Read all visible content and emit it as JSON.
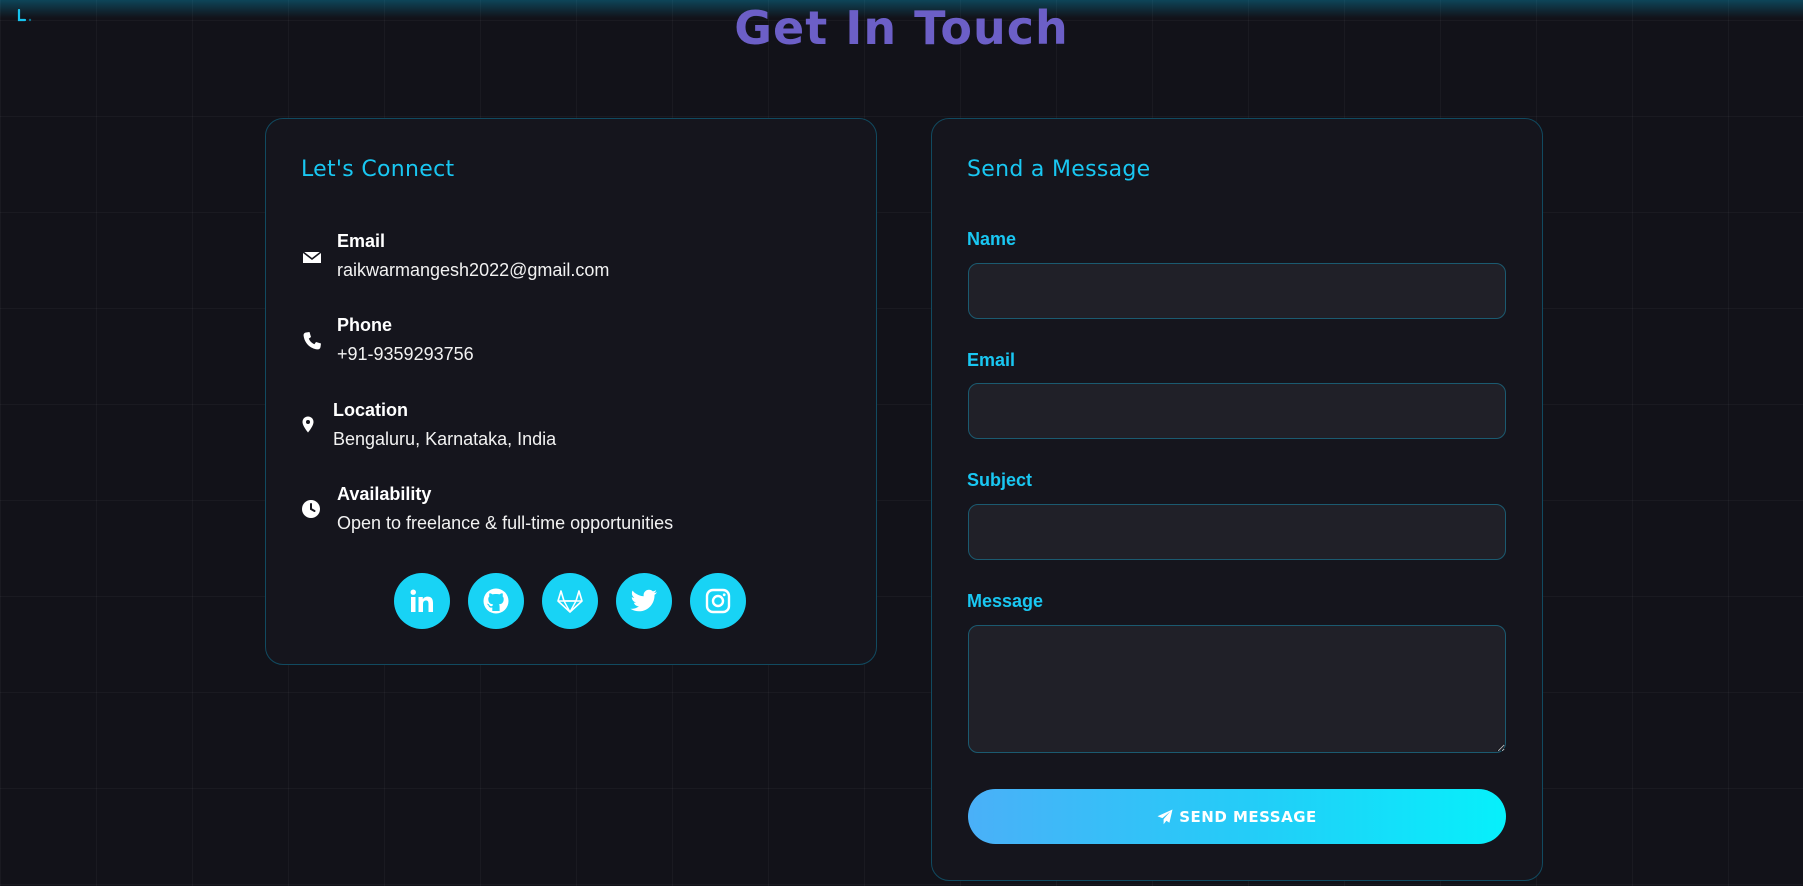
{
  "page": {
    "title": "Get In Touch"
  },
  "connect": {
    "title": "Let's Connect",
    "items": [
      {
        "label": "Email",
        "value": "raikwarmangesh2022@gmail.com",
        "icon": "envelope-icon"
      },
      {
        "label": "Phone",
        "value": "+91-9359293756",
        "icon": "phone-icon"
      },
      {
        "label": "Location",
        "value": "Bengaluru, Karnataka, India",
        "icon": "map-pin-icon"
      },
      {
        "label": "Availability",
        "value": "Open to freelance & full-time opportunities",
        "icon": "clock-icon"
      }
    ],
    "socials": [
      "linkedin-icon",
      "github-icon",
      "gitlab-icon",
      "twitter-icon",
      "instagram-icon"
    ]
  },
  "form": {
    "title": "Send a Message",
    "name_label": "Name",
    "name_value": "",
    "email_label": "Email",
    "email_value": "",
    "subject_label": "Subject",
    "subject_value": "",
    "message_label": "Message",
    "message_value": "",
    "submit_label": "SEND MESSAGE"
  },
  "colors": {
    "accent": "#19c7f2",
    "title": "#6c5fc7",
    "background": "#121219",
    "card": "#15151d"
  }
}
